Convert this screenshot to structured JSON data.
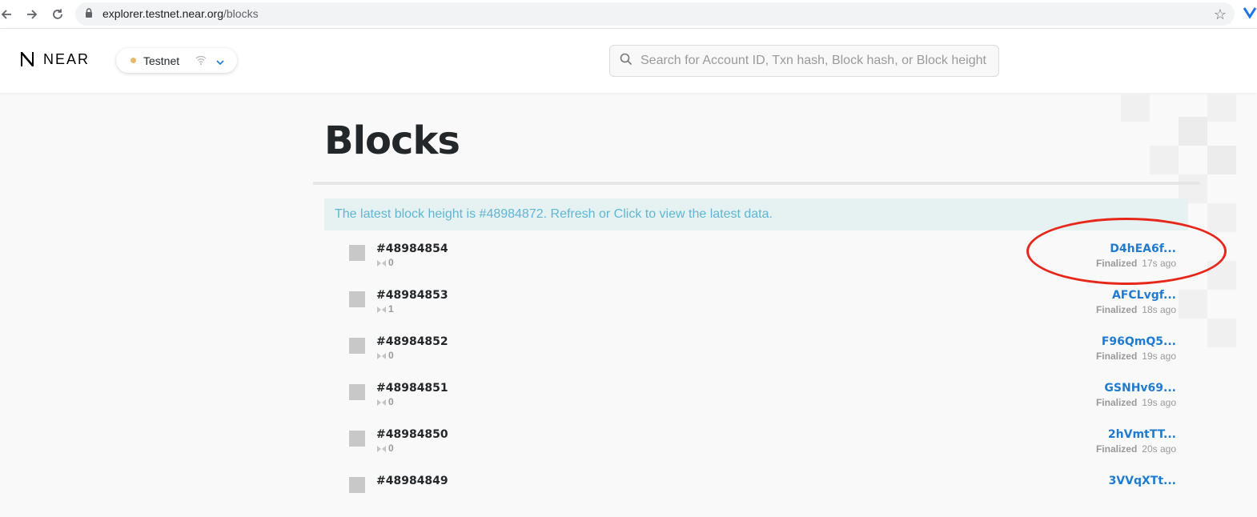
{
  "browser": {
    "url_host": "explorer.testnet.near.org",
    "url_path": "/blocks"
  },
  "header": {
    "logo_text": "NEAR",
    "network": "Testnet",
    "network_dot_color": "#e7b96c",
    "search_placeholder": "Search for Account ID, Txn hash, Block hash, or Block height"
  },
  "main": {
    "title": "Blocks",
    "banner": "The latest block height is #48984872. Refresh or Click to view the latest data.",
    "blocks": [
      {
        "height": "#48984854",
        "tx_count": "0",
        "hash": "D4hEA6f...",
        "status": "Finalized",
        "age": "17s ago"
      },
      {
        "height": "#48984853",
        "tx_count": "1",
        "hash": "AFCLvgf...",
        "status": "Finalized",
        "age": "18s ago"
      },
      {
        "height": "#48984852",
        "tx_count": "0",
        "hash": "F96QmQ5...",
        "status": "Finalized",
        "age": "19s ago"
      },
      {
        "height": "#48984851",
        "tx_count": "0",
        "hash": "GSNHv69...",
        "status": "Finalized",
        "age": "19s ago"
      },
      {
        "height": "#48984850",
        "tx_count": "0",
        "hash": "2hVmtTT...",
        "status": "Finalized",
        "age": "20s ago"
      },
      {
        "height": "#48984849",
        "tx_count": "",
        "hash": "3VVqXTt...",
        "status": "",
        "age": ""
      }
    ]
  },
  "colors": {
    "link": "#1f7bd1",
    "banner_text": "#5fb6d4",
    "banner_bg": "#e6f1f1",
    "annotation": "#e8271b"
  }
}
